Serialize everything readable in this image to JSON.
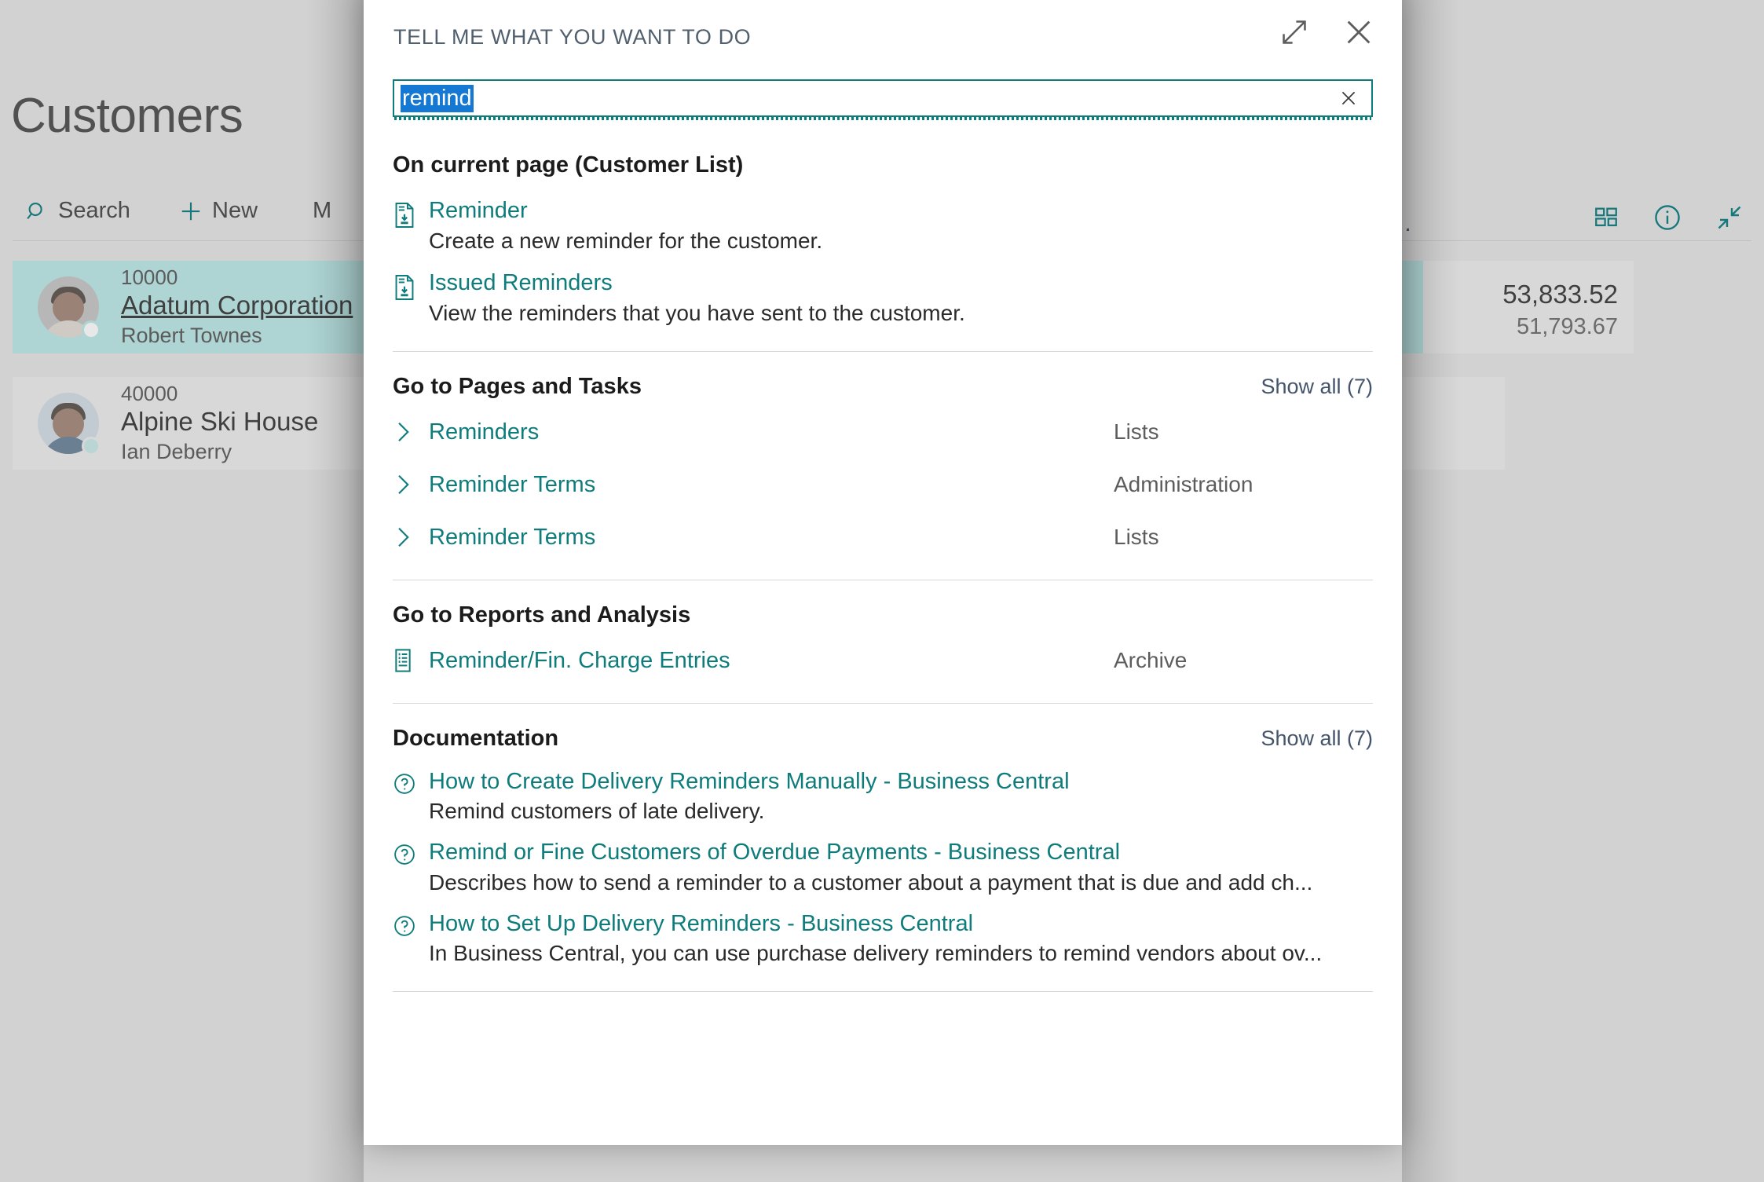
{
  "background": {
    "page_title": "Customers",
    "toolbar": {
      "search_label": "Search",
      "new_label": "New",
      "more_label": "M",
      "overflow_label": "…",
      "tiles_icon": "grid-view-icon",
      "info_icon": "info-icon",
      "collapse_icon": "collapse-icon"
    },
    "rows": [
      {
        "number": "10000",
        "name": "Adatum Corporation",
        "contact": "Robert Townes",
        "selected": true
      },
      {
        "number": "40000",
        "name": "Alpine Ski House",
        "contact": "Ian Deberry",
        "selected": false
      }
    ],
    "amounts": {
      "primary": "53,833.52",
      "secondary": "51,793.67"
    }
  },
  "dialog": {
    "title": "TELL ME WHAT YOU WANT TO DO",
    "expand_icon": "expand-diagonal-icon",
    "close_icon": "close-icon",
    "search": {
      "value": "remind",
      "placeholder": "Tell me what you want to do",
      "clear_icon": "clear-icon"
    },
    "sections": {
      "current_page": {
        "title": "On current page (Customer List)",
        "items": [
          {
            "label": "Reminder",
            "description": "Create a new reminder for the customer.",
            "icon": "document-action-icon"
          },
          {
            "label": "Issued Reminders",
            "description": "View the reminders that you have sent to the customer.",
            "icon": "document-action-icon"
          }
        ]
      },
      "pages_tasks": {
        "title": "Go to Pages and Tasks",
        "show_all": "Show all (7)",
        "items": [
          {
            "label": "Reminders",
            "category": "Lists",
            "icon": "chevron-right-icon"
          },
          {
            "label": "Reminder Terms",
            "category": "Administration",
            "icon": "chevron-right-icon"
          },
          {
            "label": "Reminder Terms",
            "category": "Lists",
            "icon": "chevron-right-icon"
          }
        ]
      },
      "reports": {
        "title": "Go to Reports and Analysis",
        "items": [
          {
            "label": "Reminder/Fin. Charge Entries",
            "category": "Archive",
            "icon": "report-list-icon"
          }
        ]
      },
      "documentation": {
        "title": "Documentation",
        "show_all": "Show all (7)",
        "items": [
          {
            "label": "How to Create Delivery Reminders Manually - Business Central",
            "description": "Remind customers of late delivery.",
            "icon": "help-circle-icon"
          },
          {
            "label": "Remind or Fine Customers of Overdue Payments - Business Central",
            "description": "Describes how to send a reminder to a customer about a payment that is due and add ch...",
            "icon": "help-circle-icon"
          },
          {
            "label": "How to Set Up Delivery Reminders - Business Central",
            "description": "In Business Central, you can use purchase delivery reminders to remind vendors about ov...",
            "icon": "help-circle-icon"
          }
        ]
      }
    }
  },
  "colors": {
    "accent_teal": "#0F7C7C",
    "selection_blue": "#1579D4",
    "row_selected": "#AED5D4",
    "slate": "#44546B"
  }
}
